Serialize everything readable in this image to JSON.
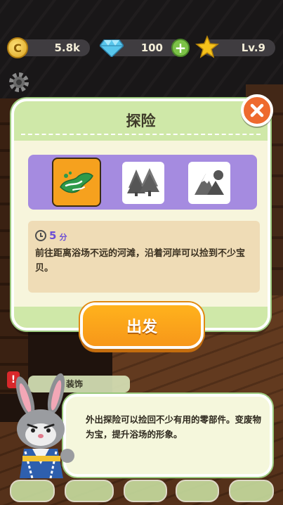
{
  "hud": {
    "coins": "5.8k",
    "gems": "100",
    "level": "Lv.9",
    "icons": [
      "coin-icon",
      "gem-icon",
      "plus-icon",
      "star-icon",
      "gear-icon"
    ]
  },
  "dialog": {
    "title": "探险",
    "options": [
      {
        "name": "river-beach",
        "icon": "river-icon",
        "selected": true
      },
      {
        "name": "forest",
        "icon": "forest-icon",
        "selected": false
      },
      {
        "name": "mountain",
        "icon": "mountain-icon",
        "selected": false
      }
    ],
    "duration_value": "5",
    "duration_unit": "分",
    "description": "前往距离浴场不远的河滩，沿着河岸可以捡到不少宝贝。",
    "go_label": "出发"
  },
  "background": {
    "task_label": "装饰",
    "alert": "!"
  },
  "tip": {
    "text": "外出探险可以捡回不少有用的零部件。变废物为宝，提升浴场的形象。"
  },
  "colors": {
    "accent_orange": "#f7971a",
    "panel_green": "#cfe8a8",
    "option_purple": "#a58be0",
    "close_red": "#ee6a2e"
  }
}
